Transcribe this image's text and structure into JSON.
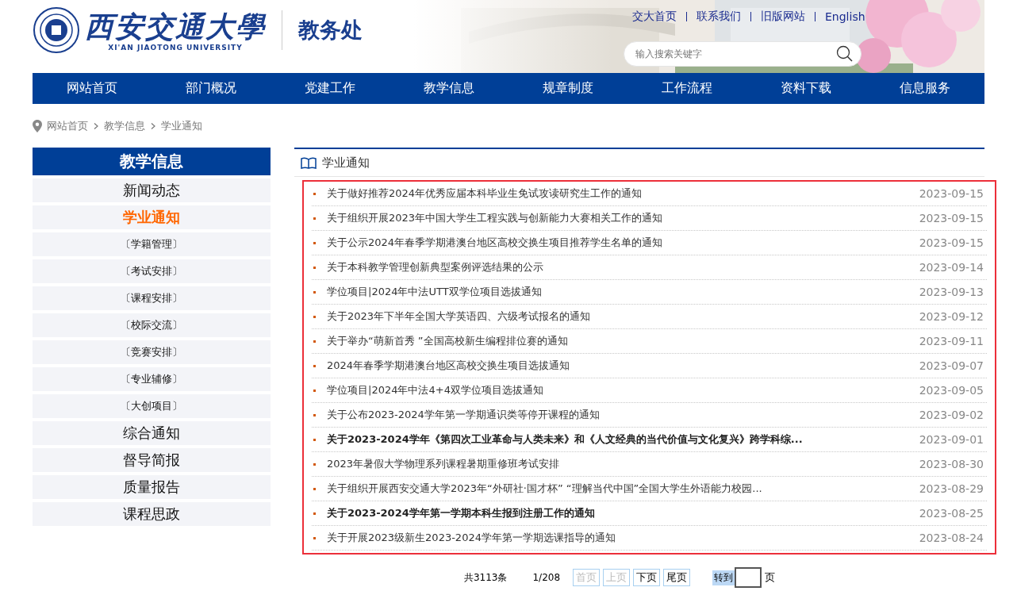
{
  "header": {
    "logo_text": "西安交通大學",
    "logo_subtitle": "XI'AN JIAOTONG UNIVERSITY",
    "office": "教务处",
    "top_links": [
      "交大首页",
      "联系我们",
      "旧版网站",
      "English"
    ],
    "search": {
      "placeholder": "输入搜索关键字"
    }
  },
  "nav": [
    "网站首页",
    "部门概况",
    "党建工作",
    "教学信息",
    "规章制度",
    "工作流程",
    "资料下载",
    "信息服务"
  ],
  "breadcrumb": [
    "网站首页",
    "教学信息",
    "学业通知"
  ],
  "sidebar": {
    "title": "教学信息",
    "items": [
      {
        "label": "新闻动态",
        "kind": "main",
        "selected": false
      },
      {
        "label": "学业通知",
        "kind": "main",
        "selected": true
      },
      {
        "label": "〔学籍管理〕",
        "kind": "sub",
        "selected": false
      },
      {
        "label": "〔考试安排〕",
        "kind": "sub",
        "selected": false
      },
      {
        "label": "〔课程安排〕",
        "kind": "sub",
        "selected": false
      },
      {
        "label": "〔校际交流〕",
        "kind": "sub",
        "selected": false
      },
      {
        "label": "〔竞赛安排〕",
        "kind": "sub",
        "selected": false
      },
      {
        "label": "〔专业辅修〕",
        "kind": "sub",
        "selected": false
      },
      {
        "label": "〔大创项目〕",
        "kind": "sub",
        "selected": false
      },
      {
        "label": "综合通知",
        "kind": "main",
        "selected": false
      },
      {
        "label": "督导简报",
        "kind": "main",
        "selected": false
      },
      {
        "label": "质量报告",
        "kind": "main",
        "selected": false
      },
      {
        "label": "课程思政",
        "kind": "main",
        "selected": false
      }
    ]
  },
  "notices": {
    "title": "学业通知",
    "highlighted": true,
    "items": [
      {
        "title": "关于做好推荐2024年优秀应届本科毕业生免试攻读研究生工作的通知",
        "date": "2023-09-15",
        "bold": false
      },
      {
        "title": "关于组织开展2023年中国大学生工程实践与创新能力大赛相关工作的通知",
        "date": "2023-09-15",
        "bold": false
      },
      {
        "title": "关于公示2024年春季学期港澳台地区高校交换生项目推荐学生名单的通知",
        "date": "2023-09-15",
        "bold": false
      },
      {
        "title": "关于本科教学管理创新典型案例评选结果的公示",
        "date": "2023-09-14",
        "bold": false
      },
      {
        "title": "学位项目|2024年中法UTT双学位项目选拔通知",
        "date": "2023-09-13",
        "bold": false
      },
      {
        "title": "关于2023年下半年全国大学英语四、六级考试报名的通知",
        "date": "2023-09-12",
        "bold": false
      },
      {
        "title": "关于举办“萌新首秀 ”全国高校新生编程排位赛的通知",
        "date": "2023-09-11",
        "bold": false
      },
      {
        "title": "2024年春季学期港澳台地区高校交换生项目选拔通知",
        "date": "2023-09-07",
        "bold": false
      },
      {
        "title": "学位项目|2024年中法4+4双学位项目选拔通知",
        "date": "2023-09-05",
        "bold": false
      },
      {
        "title": "关于公布2023-2024学年第一学期通识类等停开课程的通知",
        "date": "2023-09-02",
        "bold": false
      },
      {
        "title": "关于2023-2024学年《第四次工业革命与人类未来》和《人文经典的当代价值与文化复兴》跨学科综...",
        "date": "2023-09-01",
        "bold": true
      },
      {
        "title": "2023年暑假大学物理系列课程暑期重修班考试安排",
        "date": "2023-08-30",
        "bold": false
      },
      {
        "title": "关于组织开展西安交通大学2023年“外研社·国才杯” “理解当代中国”全国大学生外语能力校园...",
        "date": "2023-08-29",
        "bold": false
      },
      {
        "title": "关于2023-2024学年第一学期本科生报到注册工作的通知",
        "date": "2023-08-25",
        "bold": true
      },
      {
        "title": "关于开展2023级新生2023-2024学年第一学期选课指导的通知",
        "date": "2023-08-24",
        "bold": false
      }
    ]
  },
  "pagination": {
    "total": "共3113条",
    "page": "1/208",
    "buttons": [
      {
        "label": "首页",
        "disabled": true
      },
      {
        "label": "上页",
        "disabled": true
      },
      {
        "label": "下页",
        "disabled": false
      },
      {
        "label": "尾页",
        "disabled": false
      }
    ],
    "goto_label": "转到",
    "goto_suffix": "页"
  }
}
